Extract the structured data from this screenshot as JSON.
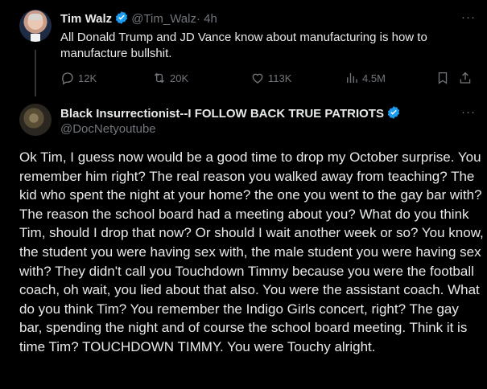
{
  "post1": {
    "name": "Tim Walz",
    "handle": "@Tim_Walz",
    "time": "· 4h",
    "text": "All Donald Trump and JD Vance know about manufacturing is how to manufacture bullshit.",
    "replies": "12K",
    "reposts": "20K",
    "likes": "113K",
    "views": "4.5M",
    "more": "···"
  },
  "post2": {
    "name": "Black Insurrectionist--I FOLLOW BACK TRUE PATRIOTS",
    "handle": "@DocNetyoutube",
    "more": "···",
    "text": "Ok Tim, I guess now would be a good time to drop my October surprise. You remember him right? The real reason you walked away from teaching? The kid who spent the night at your home? the one you went to the gay bar with? The reason the school board had a meeting about you? What do you think Tim, should I drop that now? Or should I wait another week or so? You know, the student you were having sex with, the male student you were having sex with? They didn't call you Touchdown Timmy because you were the football coach, oh wait, you lied about that also. You were the assistant coach. What do you think Tim? You remember the Indigo Girls concert, right? The gay bar, spending the night and of course the school board meeting. Think it is time Tim? TOUCHDOWN TIMMY. You were Touchy alright."
  },
  "colors": {
    "background": "#000000",
    "text": "#e7e9ea",
    "muted": "#71767b",
    "verified": "#1d9bf0"
  }
}
